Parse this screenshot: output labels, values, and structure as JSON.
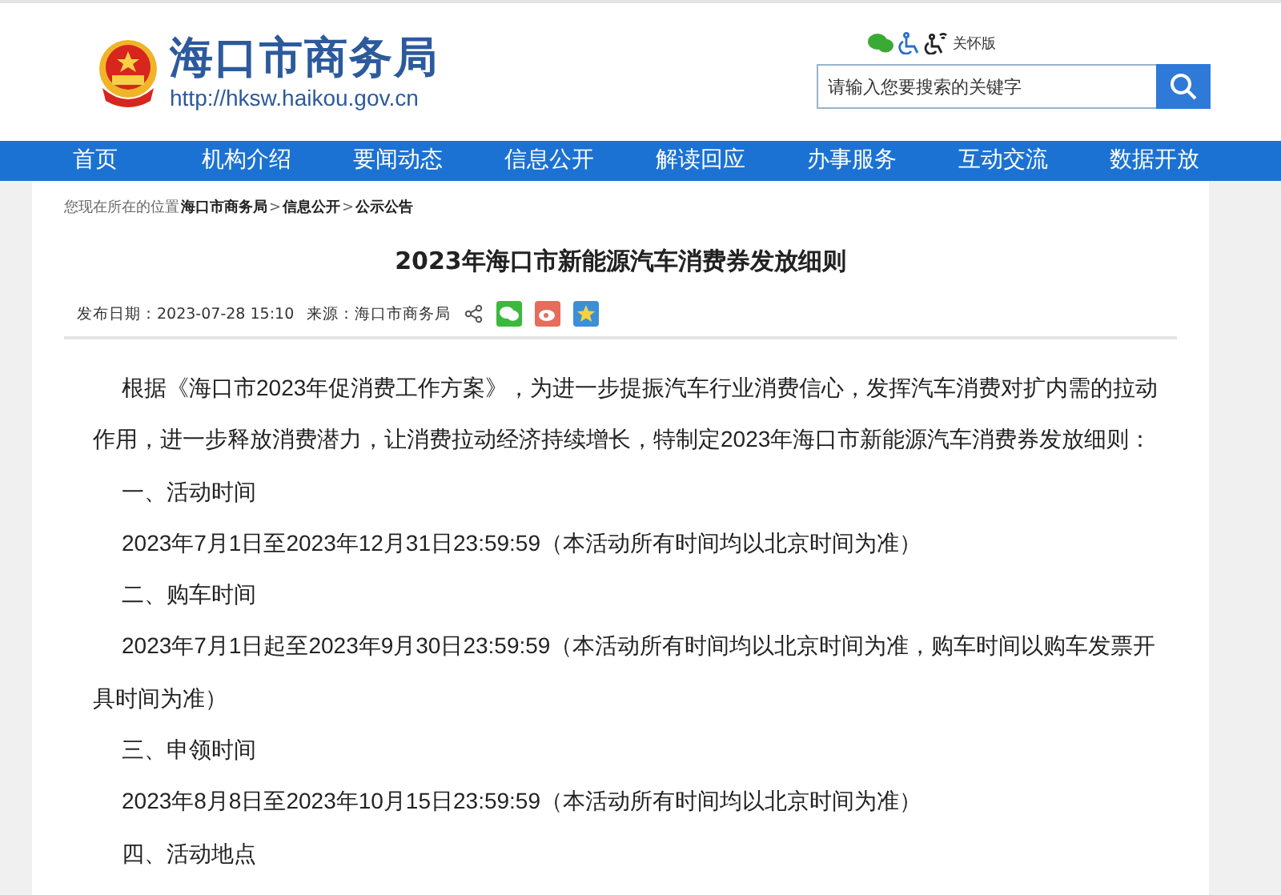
{
  "header": {
    "site_name": "海口市商务局",
    "site_url": "http://hksw.haikou.gov.cn",
    "care_mode": "关怀版",
    "search": {
      "placeholder": "请输入您要搜索的关键字"
    }
  },
  "nav": [
    {
      "label": "首页"
    },
    {
      "label": "机构介绍"
    },
    {
      "label": "要闻动态"
    },
    {
      "label": "信息公开"
    },
    {
      "label": "解读回应"
    },
    {
      "label": "办事服务"
    },
    {
      "label": "互动交流"
    },
    {
      "label": "数据开放"
    }
  ],
  "breadcrumb": {
    "prefix": "您现在所在的位置",
    "items": [
      "海口市商务局",
      "信息公开",
      "公示公告"
    ],
    "separator": ">"
  },
  "article": {
    "title": "2023年海口市新能源汽车消费券发放细则",
    "publish_date": "发布日期：2023-07-28 15:10",
    "source": "来源：海口市商务局",
    "paragraphs": [
      "根据《海口市2023年促消费工作方案》，为进一步提振汽车行业消费信心，发挥汽车消费对扩内需的拉动作用，进一步释放消费潜力，让消费拉动经济持续增长，特制定2023年海口市新能源汽车消费券发放细则：",
      "一、活动时间",
      "2023年7月1日至2023年12月31日23:59:59（本活动所有时间均以北京时间为准）",
      "二、购车时间",
      "2023年7月1日起至2023年9月30日23:59:59（本活动所有时间均以北京时间为准，购车时间以购车发票开具时间为准）",
      "三、申领时间",
      "2023年8月8日至2023年10月15日23:59:59（本活动所有时间均以北京时间为准）",
      "四、活动地点"
    ]
  }
}
